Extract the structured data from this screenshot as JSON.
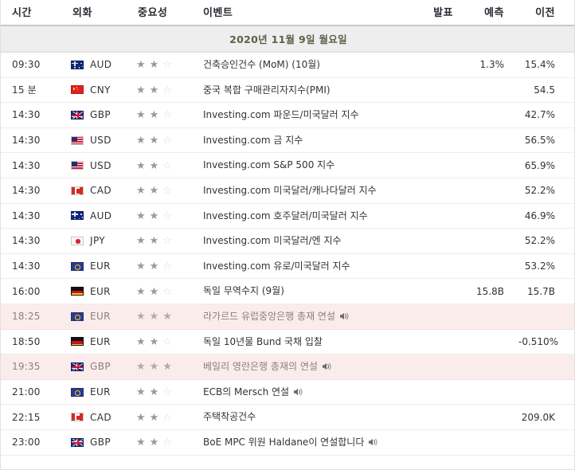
{
  "table": {
    "headers": {
      "time": "시간",
      "currency": "외화",
      "importance": "중요성",
      "event": "이벤트",
      "actual": "발표",
      "forecast": "예측",
      "previous": "이전"
    },
    "date_header": "2020년 11월 9일 월요일",
    "rows": [
      {
        "time": "09:30",
        "currency": "AUD",
        "flag": "aud-flag",
        "stars": 2,
        "total_stars": 3,
        "event": "건축승인건수 (MoM) (10월)",
        "speaker": false,
        "highlighted": false,
        "actual": "",
        "forecast": "1.3%",
        "previous": "15.4%"
      },
      {
        "time": "15 분",
        "currency": "CNY",
        "flag": "cny-flag",
        "stars": 2,
        "total_stars": 3,
        "event": "중국 복합 구매관리자지수(PMI)",
        "speaker": false,
        "highlighted": false,
        "actual": "",
        "forecast": "",
        "previous": "54.5"
      },
      {
        "time": "14:30",
        "currency": "GBP",
        "flag": "gbp-flag",
        "stars": 2,
        "total_stars": 3,
        "event": "Investing.com 파운드/미국달러 지수",
        "speaker": false,
        "highlighted": false,
        "actual": "",
        "forecast": "",
        "previous": "42.7%"
      },
      {
        "time": "14:30",
        "currency": "USD",
        "flag": "usd-flag",
        "stars": 2,
        "total_stars": 3,
        "event": "Investing.com 금 지수",
        "speaker": false,
        "highlighted": false,
        "actual": "",
        "forecast": "",
        "previous": "56.5%"
      },
      {
        "time": "14:30",
        "currency": "USD",
        "flag": "usd-flag",
        "stars": 2,
        "total_stars": 3,
        "event": "Investing.com S&P 500 지수",
        "speaker": false,
        "highlighted": false,
        "actual": "",
        "forecast": "",
        "previous": "65.9%"
      },
      {
        "time": "14:30",
        "currency": "CAD",
        "flag": "cad-flag",
        "stars": 2,
        "total_stars": 3,
        "event": "Investing.com 미국달러/캐나다달러 지수",
        "speaker": false,
        "highlighted": false,
        "actual": "",
        "forecast": "",
        "previous": "52.2%"
      },
      {
        "time": "14:30",
        "currency": "AUD",
        "flag": "aud-flag",
        "stars": 2,
        "total_stars": 3,
        "event": "Investing.com 호주달러/미국달러 지수",
        "speaker": false,
        "highlighted": false,
        "actual": "",
        "forecast": "",
        "previous": "46.9%"
      },
      {
        "time": "14:30",
        "currency": "JPY",
        "flag": "jpy-flag",
        "stars": 2,
        "total_stars": 3,
        "event": "Investing.com 미국달러/엔 지수",
        "speaker": false,
        "highlighted": false,
        "actual": "",
        "forecast": "",
        "previous": "52.2%"
      },
      {
        "time": "14:30",
        "currency": "EUR",
        "flag": "eur-flag",
        "stars": 2,
        "total_stars": 3,
        "event": "Investing.com 유로/미국달러 지수",
        "speaker": false,
        "highlighted": false,
        "actual": "",
        "forecast": "",
        "previous": "53.2%"
      },
      {
        "time": "16:00",
        "currency": "EUR",
        "flag": "deu-flag",
        "stars": 2,
        "total_stars": 3,
        "event": "독일 무역수지 (9월)",
        "speaker": false,
        "highlighted": false,
        "actual": "",
        "forecast": "15.8B",
        "previous": "15.7B"
      },
      {
        "time": "18:25",
        "currency": "EUR",
        "flag": "eur-flag",
        "stars": 3,
        "total_stars": 3,
        "event": "라가르드 유럽중앙은행 총재 연설",
        "speaker": true,
        "highlighted": true,
        "actual": "",
        "forecast": "",
        "previous": ""
      },
      {
        "time": "18:50",
        "currency": "EUR",
        "flag": "deu-flag",
        "stars": 2,
        "total_stars": 3,
        "event": "독일 10년물 Bund 국채 입찰",
        "speaker": false,
        "highlighted": false,
        "actual": "",
        "forecast": "",
        "previous": "-0.510%"
      },
      {
        "time": "19:35",
        "currency": "GBP",
        "flag": "gbp-flag",
        "stars": 3,
        "total_stars": 3,
        "event": "베일리 영란은행 총재의 연설",
        "speaker": true,
        "highlighted": true,
        "actual": "",
        "forecast": "",
        "previous": ""
      },
      {
        "time": "21:00",
        "currency": "EUR",
        "flag": "eur-flag",
        "stars": 2,
        "total_stars": 3,
        "event": "ECB의 Mersch 연설",
        "speaker": true,
        "highlighted": false,
        "actual": "",
        "forecast": "",
        "previous": ""
      },
      {
        "time": "22:15",
        "currency": "CAD",
        "flag": "cad-flag",
        "stars": 2,
        "total_stars": 3,
        "event": "주택착공건수",
        "speaker": false,
        "highlighted": false,
        "actual": "",
        "forecast": "",
        "previous": "209.0K"
      },
      {
        "time": "23:00",
        "currency": "GBP",
        "flag": "gbp-flag",
        "stars": 2,
        "total_stars": 3,
        "event": "BoE MPC 위원 Haldane이 연설합니다",
        "speaker": true,
        "highlighted": false,
        "actual": "",
        "forecast": "",
        "previous": ""
      }
    ]
  },
  "icons": {
    "star_filled": "★",
    "star_empty": "☆",
    "speaker": "speaker-icon"
  },
  "colors": {
    "header_text": "#2b2b35",
    "date_bar_bg": "#eeeeee",
    "date_bar_text": "#5f5f4a",
    "row_text": "#333333",
    "highlight_bg": "#fbecec",
    "highlight_text": "#8e7e7e",
    "star_on": "#999999",
    "star_off": "#dcdcdc"
  }
}
